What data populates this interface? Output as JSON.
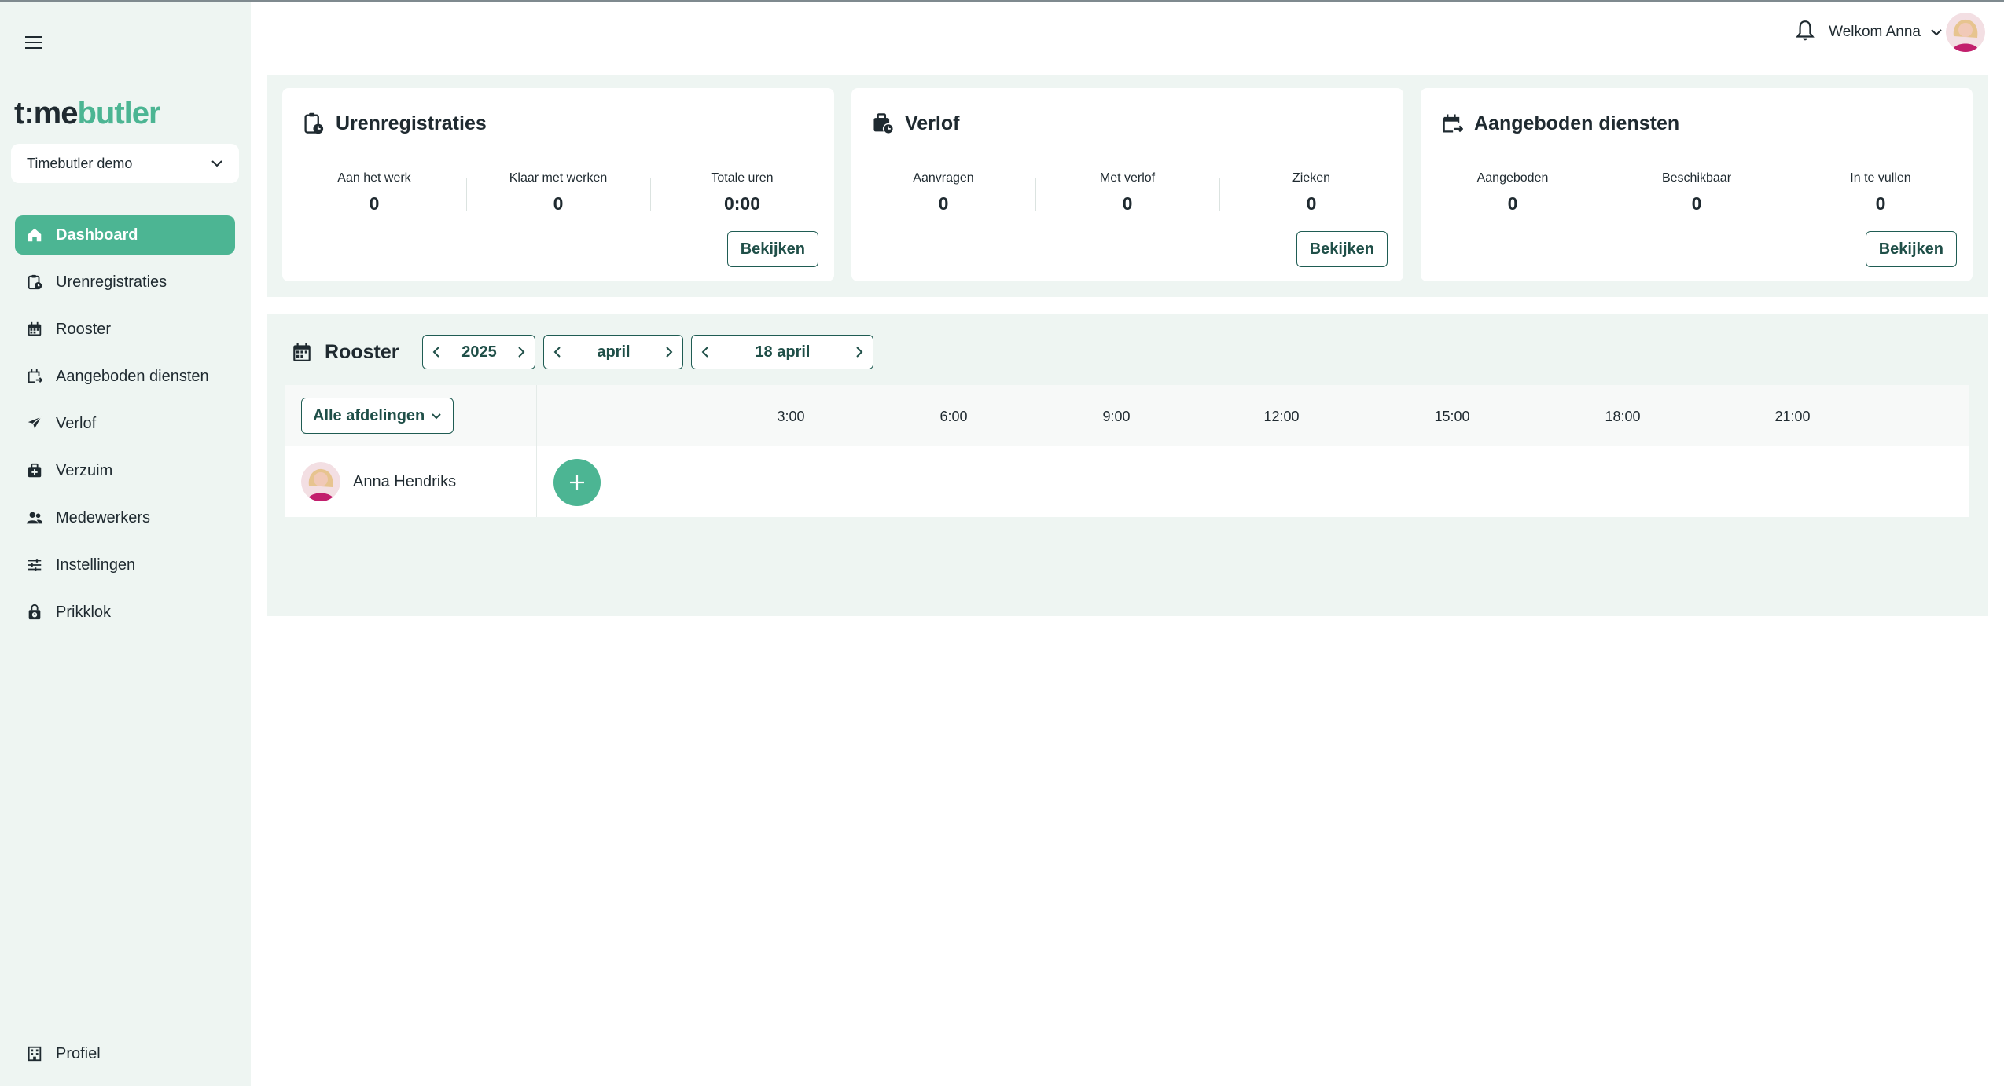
{
  "sidebar": {
    "logo": {
      "part1": "t:me",
      "part2": "butler"
    },
    "company": "Timebutler demo",
    "items": [
      {
        "label": "Dashboard",
        "icon": "home-icon"
      },
      {
        "label": "Urenregistraties",
        "icon": "clipboard-clock-icon"
      },
      {
        "label": "Rooster",
        "icon": "calendar-icon"
      },
      {
        "label": "Aangeboden diensten",
        "icon": "calendar-arrow-icon"
      },
      {
        "label": "Verlof",
        "icon": "airplane-icon"
      },
      {
        "label": "Verzuim",
        "icon": "medical-bag-icon"
      },
      {
        "label": "Medewerkers",
        "icon": "people-icon"
      },
      {
        "label": "Instellingen",
        "icon": "sliders-icon"
      },
      {
        "label": "Prikklok",
        "icon": "lock-clock-icon"
      }
    ],
    "profile": {
      "label": "Profiel",
      "icon": "building-icon"
    }
  },
  "header": {
    "welcome": "Welkom Anna"
  },
  "cards": [
    {
      "title": "Urenregistraties",
      "stats": [
        {
          "label": "Aan het werk",
          "value": "0"
        },
        {
          "label": "Klaar met werken",
          "value": "0"
        },
        {
          "label": "Totale uren",
          "value": "0:00"
        }
      ],
      "button": "Bekijken"
    },
    {
      "title": "Verlof",
      "stats": [
        {
          "label": "Aanvragen",
          "value": "0"
        },
        {
          "label": "Met verlof",
          "value": "0"
        },
        {
          "label": "Zieken",
          "value": "0"
        }
      ],
      "button": "Bekijken"
    },
    {
      "title": "Aangeboden diensten",
      "stats": [
        {
          "label": "Aangeboden",
          "value": "0"
        },
        {
          "label": "Beschikbaar",
          "value": "0"
        },
        {
          "label": "In te vullen",
          "value": "0"
        }
      ],
      "button": "Bekijken"
    }
  ],
  "roster": {
    "title": "Rooster",
    "year": "2025",
    "month": "april",
    "day": "18 april",
    "department": "Alle afdelingen",
    "hours": [
      "3:00",
      "6:00",
      "9:00",
      "12:00",
      "15:00",
      "18:00",
      "21:00"
    ],
    "employee": "Anna Hendriks"
  },
  "colors": {
    "accent": "#4cb593",
    "sidebar_bg": "#eef5f2",
    "button_border": "#1f5c53"
  }
}
